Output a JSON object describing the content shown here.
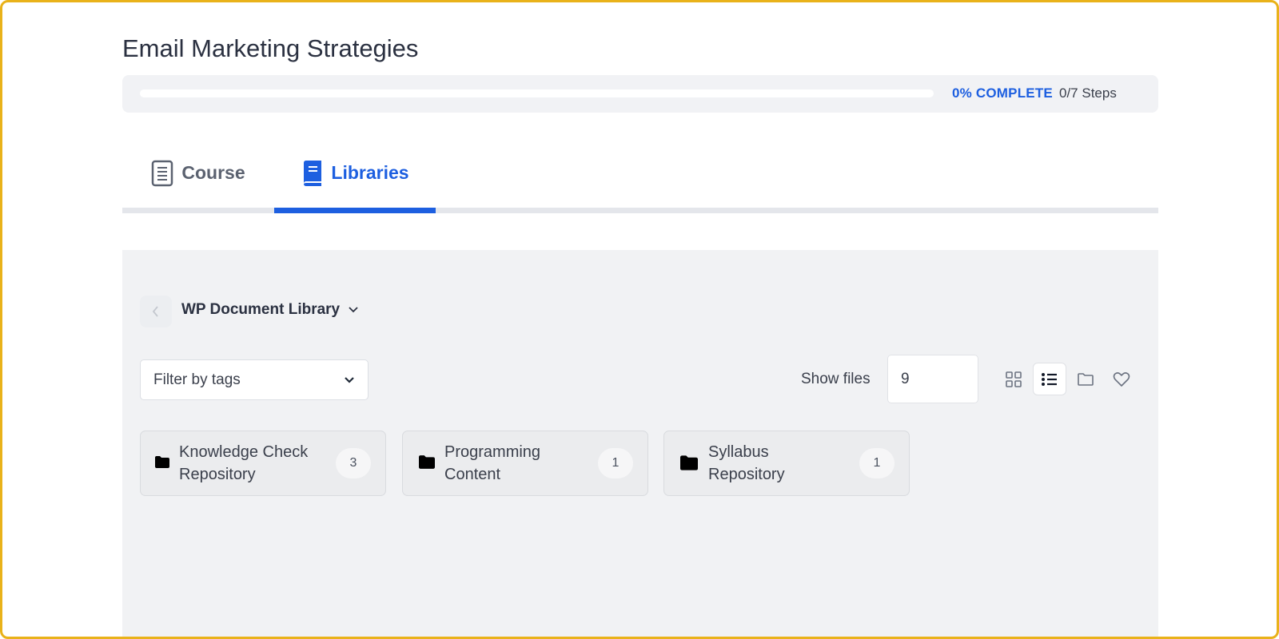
{
  "page": {
    "title": "Email Marketing Strategies"
  },
  "progress": {
    "percent_label": "0% COMPLETE",
    "steps_label": "0/7 Steps",
    "value": 0
  },
  "tabs": [
    {
      "label": "Course",
      "icon": "document-icon",
      "active": false
    },
    {
      "label": "Libraries",
      "icon": "book-icon",
      "active": true
    }
  ],
  "library": {
    "name": "WP Document Library",
    "filter_placeholder": "Filter by tags",
    "show_files_label": "Show files",
    "show_files_value": "9",
    "views": [
      "grid-view-icon",
      "list-view-icon",
      "folder-view-icon",
      "favorites-icon"
    ],
    "active_view": "list-view-icon"
  },
  "folders": [
    {
      "name": "Knowledge Check Repository",
      "line1": "Knowledge Check",
      "line2": "Repository",
      "count": "3"
    },
    {
      "name": "Programming Content",
      "line1": "Programming",
      "line2": "Content",
      "count": "1"
    },
    {
      "name": "Syllabus Repository",
      "line1": "Syllabus",
      "line2": "Repository",
      "count": "1"
    }
  ],
  "colors": {
    "accent": "#1d5fe0",
    "frame_border": "#e9b21a",
    "panel_bg": "#f1f2f4"
  }
}
